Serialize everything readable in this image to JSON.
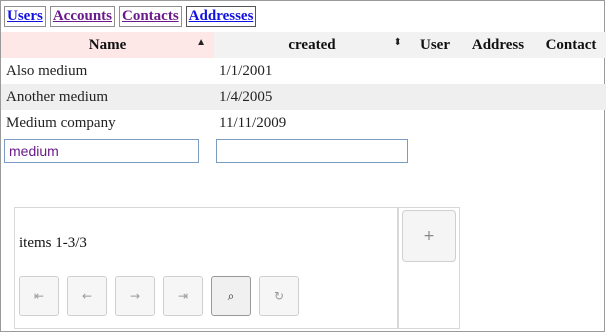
{
  "tabs": [
    {
      "label": "Users"
    },
    {
      "label": "Accounts"
    },
    {
      "label": "Contacts"
    },
    {
      "label": "Addresses"
    }
  ],
  "table": {
    "columns": [
      "Name",
      "created",
      "User",
      "Address",
      "Contact"
    ],
    "sort_indicators": {
      "name": "▲",
      "created": "⬍"
    },
    "rows": [
      {
        "name": "Also medium",
        "created": "1/1/2001",
        "user": "",
        "address": "",
        "contact": ""
      },
      {
        "name": "Another medium",
        "created": "1/4/2005",
        "user": "",
        "address": "",
        "contact": ""
      },
      {
        "name": "Medium company",
        "created": "11/11/2009",
        "user": "",
        "address": "",
        "contact": ""
      }
    ],
    "filters": {
      "name": "medium",
      "created": ""
    }
  },
  "pager": {
    "info": "items 1-3/3",
    "buttons": {
      "first": "⇤",
      "prev": "←",
      "next": "→",
      "last": "⇥",
      "search": "⌕",
      "refresh": "↻"
    }
  },
  "add_button": {
    "label": "+"
  }
}
